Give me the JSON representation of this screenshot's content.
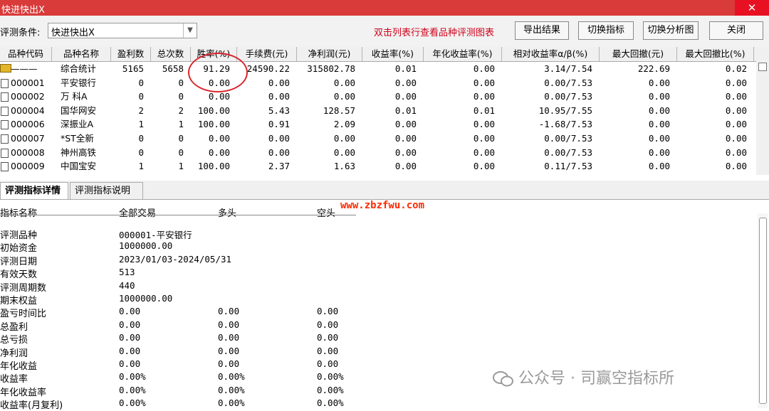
{
  "window": {
    "title": "快进快出X",
    "close_glyph": "✕"
  },
  "toolbar": {
    "condition_label": "评测条件:",
    "condition_value": "快进快出X",
    "hint": "双击列表行查看品种评测图表",
    "buttons": [
      "导出结果",
      "切换指标",
      "切换分析图",
      "关闭"
    ]
  },
  "table": {
    "columns": [
      "品种代码",
      "品种名称",
      "盈利数",
      "总次数",
      "胜率(%)",
      "手续费(元)",
      "净利润(元)",
      "收益率(%)",
      "年化收益率(%)",
      "相对收益率α/β(%)",
      "最大回撤(元)",
      "最大回撤比(%)"
    ],
    "rows": [
      {
        "code": "———",
        "name": "综合统计",
        "profit_count": "5165",
        "total_count": "5658",
        "win_rate": "91.29",
        "fee": "24590.22",
        "net_profit": "315802.78",
        "return": "0.01",
        "annual_return": "0.00",
        "relative": "3.14/7.54",
        "max_dd": "222.69",
        "max_dd_ratio": "0.02",
        "summary": true
      },
      {
        "code": "000001",
        "name": "平安银行",
        "profit_count": "0",
        "total_count": "0",
        "win_rate": "0.00",
        "fee": "0.00",
        "net_profit": "0.00",
        "return": "0.00",
        "annual_return": "0.00",
        "relative": "0.00/7.53",
        "max_dd": "0.00",
        "max_dd_ratio": "0.00"
      },
      {
        "code": "000002",
        "name": "万 科A",
        "profit_count": "0",
        "total_count": "0",
        "win_rate": "0.00",
        "fee": "0.00",
        "net_profit": "0.00",
        "return": "0.00",
        "annual_return": "0.00",
        "relative": "0.00/7.53",
        "max_dd": "0.00",
        "max_dd_ratio": "0.00"
      },
      {
        "code": "000004",
        "name": "国华网安",
        "profit_count": "2",
        "total_count": "2",
        "win_rate": "100.00",
        "fee": "5.43",
        "net_profit": "128.57",
        "return": "0.01",
        "annual_return": "0.01",
        "relative": "10.95/7.55",
        "max_dd": "0.00",
        "max_dd_ratio": "0.00"
      },
      {
        "code": "000006",
        "name": "深振业A",
        "profit_count": "1",
        "total_count": "1",
        "win_rate": "100.00",
        "fee": "0.91",
        "net_profit": "2.09",
        "return": "0.00",
        "annual_return": "0.00",
        "relative": "-1.68/7.53",
        "max_dd": "0.00",
        "max_dd_ratio": "0.00"
      },
      {
        "code": "000007",
        "name": "*ST全新",
        "profit_count": "0",
        "total_count": "0",
        "win_rate": "0.00",
        "fee": "0.00",
        "net_profit": "0.00",
        "return": "0.00",
        "annual_return": "0.00",
        "relative": "0.00/7.53",
        "max_dd": "0.00",
        "max_dd_ratio": "0.00"
      },
      {
        "code": "000008",
        "name": "神州高铁",
        "profit_count": "0",
        "total_count": "0",
        "win_rate": "0.00",
        "fee": "0.00",
        "net_profit": "0.00",
        "return": "0.00",
        "annual_return": "0.00",
        "relative": "0.00/7.53",
        "max_dd": "0.00",
        "max_dd_ratio": "0.00"
      },
      {
        "code": "000009",
        "name": "中国宝安",
        "profit_count": "1",
        "total_count": "1",
        "win_rate": "100.00",
        "fee": "2.37",
        "net_profit": "1.63",
        "return": "0.00",
        "annual_return": "0.00",
        "relative": "0.11/7.53",
        "max_dd": "0.00",
        "max_dd_ratio": "0.00"
      }
    ]
  },
  "tabs": [
    "评测指标详情",
    "评测指标说明"
  ],
  "details": {
    "headers": [
      "指标名称",
      "全部交易",
      "多头",
      "空头"
    ],
    "rows": [
      {
        "label": "评测品种",
        "all": "000001-平安银行",
        "long": "",
        "short": ""
      },
      {
        "label": "初始资金",
        "all": "1000000.00",
        "long": "",
        "short": ""
      },
      {
        "label": "评测日期",
        "all": "2023/01/03-2024/05/31",
        "long": "",
        "short": ""
      },
      {
        "label": "有效天数",
        "all": "513",
        "long": "",
        "short": ""
      },
      {
        "label": "评测周期数",
        "all": "440",
        "long": "",
        "short": ""
      },
      {
        "label": "期末权益",
        "all": "1000000.00",
        "long": "",
        "short": ""
      },
      {
        "label": "盈亏时间比",
        "all": "0.00",
        "long": "0.00",
        "short": "0.00"
      },
      {
        "label": "总盈利",
        "all": "0.00",
        "long": "0.00",
        "short": "0.00"
      },
      {
        "label": "总亏损",
        "all": "0.00",
        "long": "0.00",
        "short": "0.00"
      },
      {
        "label": "净利润",
        "all": "0.00",
        "long": "0.00",
        "short": "0.00"
      },
      {
        "label": "年化收益",
        "all": "0.00",
        "long": "0.00",
        "short": "0.00"
      },
      {
        "label": "收益率",
        "all": "0.00%",
        "long": "0.00%",
        "short": "0.00%"
      },
      {
        "label": "年化收益率",
        "all": "0.00%",
        "long": "0.00%",
        "short": "0.00%"
      },
      {
        "label": "收益率(月复利)",
        "all": "0.00%",
        "long": "0.00%",
        "short": "0.00%"
      }
    ]
  },
  "watermark": "www.zbzfwu.com",
  "wechat": "公众号 · 司赢空指标所",
  "colors": {
    "title_bar": "#d93a3a",
    "hint_red": "#d0021b",
    "circle_red": "#d8262d",
    "watermark": "#ff2a00"
  }
}
